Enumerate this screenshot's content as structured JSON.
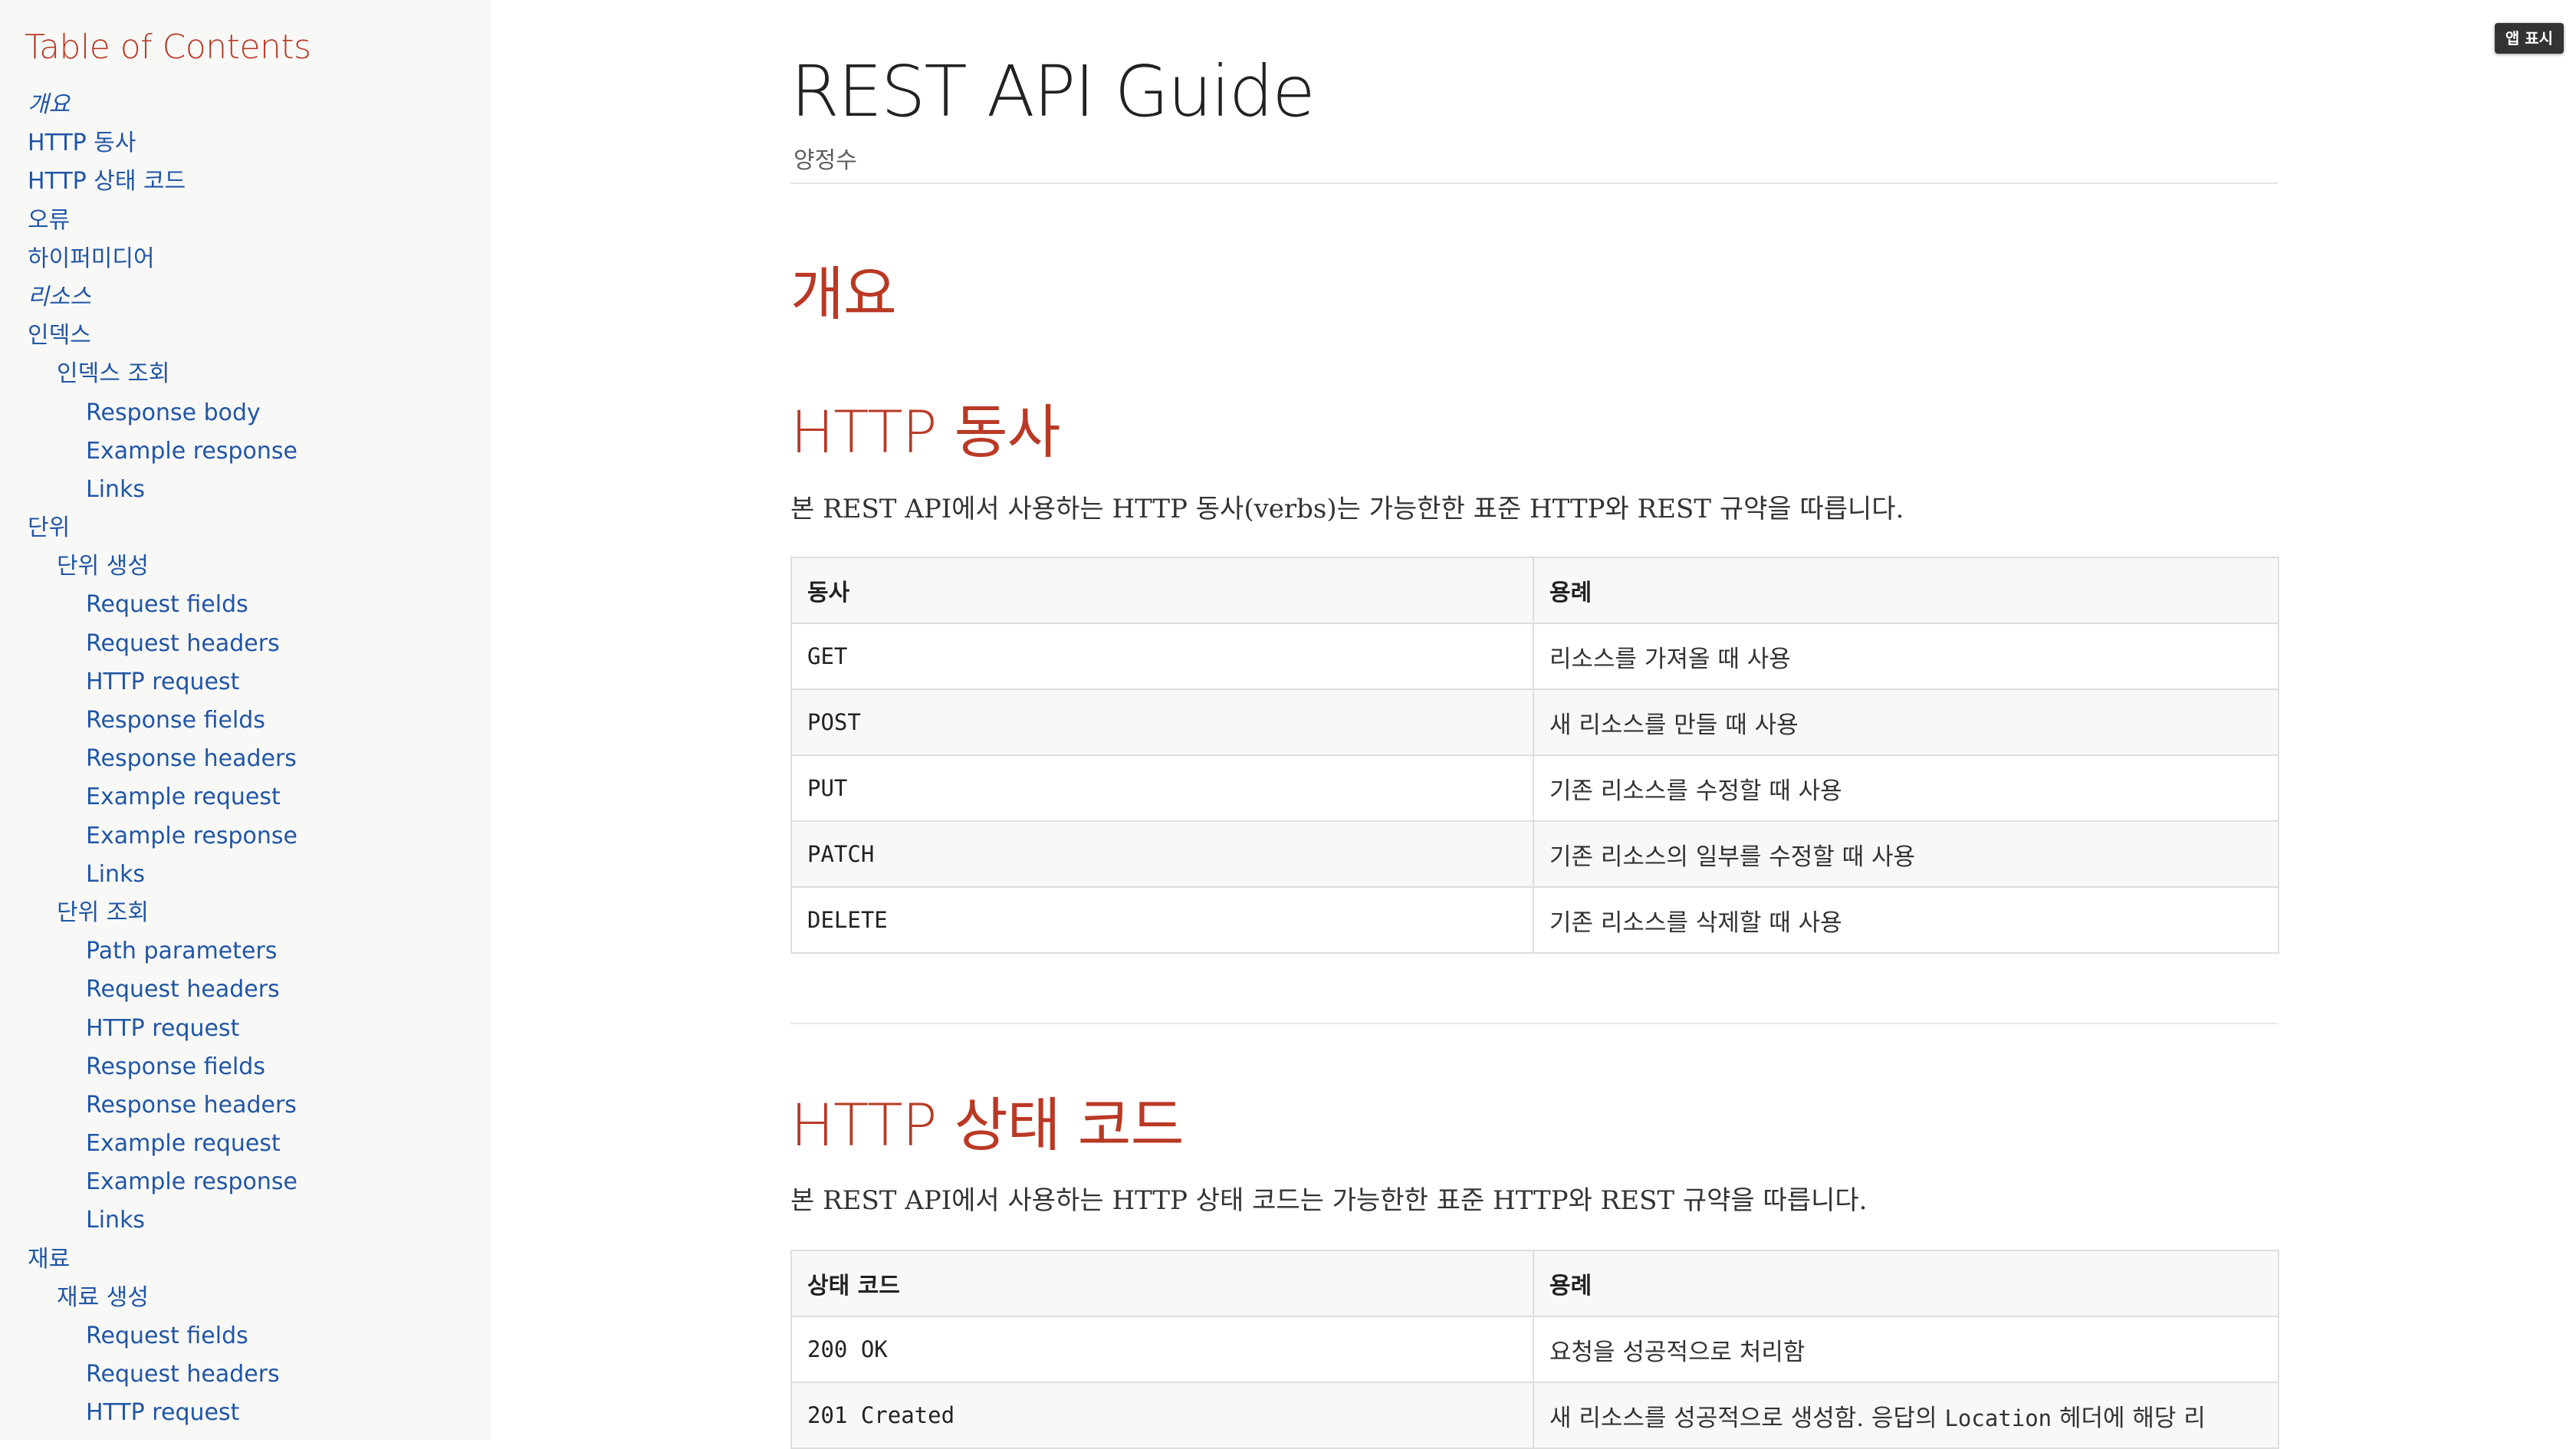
{
  "toc": {
    "title": "Table of Contents",
    "items": [
      {
        "label": "개요",
        "level": 1,
        "italic": true
      },
      {
        "label": "HTTP 동사",
        "level": 1
      },
      {
        "label": "HTTP 상태 코드",
        "level": 1
      },
      {
        "label": "오류",
        "level": 1
      },
      {
        "label": "하이퍼미디어",
        "level": 1
      },
      {
        "label": "리소스",
        "level": 1,
        "italic": true
      },
      {
        "label": "인덱스",
        "level": 1
      },
      {
        "label": "인덱스 조회",
        "level": 2
      },
      {
        "label": "Response body",
        "level": 3
      },
      {
        "label": "Example response",
        "level": 3
      },
      {
        "label": "Links",
        "level": 3
      },
      {
        "label": "단위",
        "level": 1
      },
      {
        "label": "단위 생성",
        "level": 2
      },
      {
        "label": "Request fields",
        "level": 3
      },
      {
        "label": "Request headers",
        "level": 3
      },
      {
        "label": "HTTP request",
        "level": 3
      },
      {
        "label": "Response fields",
        "level": 3
      },
      {
        "label": "Response headers",
        "level": 3
      },
      {
        "label": "Example request",
        "level": 3
      },
      {
        "label": "Example response",
        "level": 3
      },
      {
        "label": "Links",
        "level": 3
      },
      {
        "label": "단위 조회",
        "level": 2
      },
      {
        "label": "Path parameters",
        "level": 3
      },
      {
        "label": "Request headers",
        "level": 3
      },
      {
        "label": "HTTP request",
        "level": 3
      },
      {
        "label": "Response fields",
        "level": 3
      },
      {
        "label": "Response headers",
        "level": 3
      },
      {
        "label": "Example request",
        "level": 3
      },
      {
        "label": "Example response",
        "level": 3
      },
      {
        "label": "Links",
        "level": 3
      },
      {
        "label": "재료",
        "level": 1
      },
      {
        "label": "재료 생성",
        "level": 2
      },
      {
        "label": "Request fields",
        "level": 3
      },
      {
        "label": "Request headers",
        "level": 3
      },
      {
        "label": "HTTP request",
        "level": 3
      }
    ]
  },
  "toolbar": {
    "app_badge": "앱 표시"
  },
  "doc": {
    "title": "REST API Guide",
    "author": "양정수"
  },
  "sections": {
    "overview": {
      "title": "개요"
    },
    "verbs": {
      "title": "HTTP 동사",
      "intro": "본 REST API에서 사용하는 HTTP 동사(verbs)는 가능한한 표준 HTTP와 REST 규약을 따릅니다.",
      "headers": [
        "동사",
        "용례"
      ],
      "rows": [
        [
          "GET",
          "리소스를 가져올 때 사용"
        ],
        [
          "POST",
          "새 리소스를 만들 때 사용"
        ],
        [
          "PUT",
          "기존 리소스를 수정할 때 사용"
        ],
        [
          "PATCH",
          "기존 리소스의 일부를 수정할 때 사용"
        ],
        [
          "DELETE",
          "기존 리소스를 삭제할 때 사용"
        ]
      ]
    },
    "status": {
      "title": "HTTP 상태 코드",
      "intro": "본 REST API에서 사용하는 HTTP 상태 코드는 가능한한 표준 HTTP와 REST 규약을 따릅니다.",
      "headers": [
        "상태 코드",
        "용례"
      ],
      "rows": [
        [
          "200 OK",
          "요청을 성공적으로 처리함"
        ],
        [
          "201 Created",
          "새 리소스를 성공적으로 생성함. 응답의 ",
          "Location",
          " 헤더에 해당 리"
        ]
      ]
    }
  }
}
